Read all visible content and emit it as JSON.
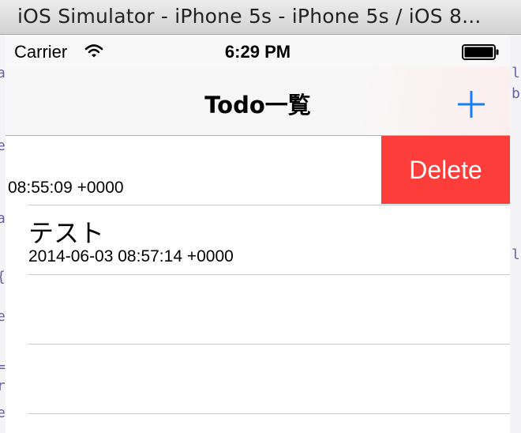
{
  "window": {
    "title": "iOS Simulator - iPhone 5s - iPhone 5s / iOS 8..."
  },
  "status_bar": {
    "carrier": "Carrier",
    "time": "6:29 PM"
  },
  "nav_bar": {
    "title": "Todo一覧",
    "add_icon": "plus-icon"
  },
  "todos": [
    {
      "title": "",
      "date": "08:55:09 +0000",
      "swiped_open": true,
      "delete_label": "Delete"
    },
    {
      "title": "テスト",
      "date": "2014-06-03 08:57:14 +0000",
      "swiped_open": false
    }
  ],
  "colors": {
    "accent": "#157efb",
    "delete": "#fc3d39"
  }
}
